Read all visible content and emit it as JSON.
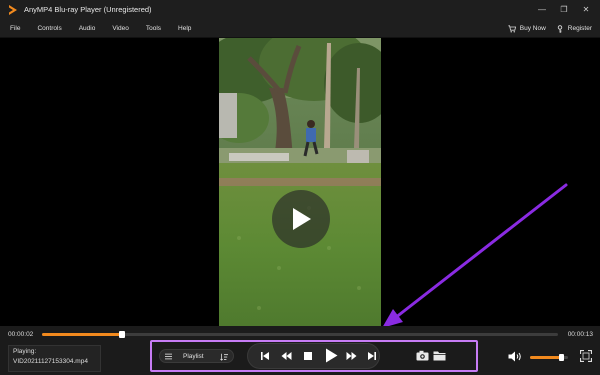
{
  "window": {
    "title": "AnyMP4 Blu-ray Player (Unregistered)",
    "minimize_glyph": "—",
    "restore_glyph": "❐",
    "close_glyph": "✕"
  },
  "menu": {
    "items": [
      "File",
      "Controls",
      "Audio",
      "Video",
      "Tools",
      "Help"
    ],
    "buy_now": "Buy Now",
    "register": "Register"
  },
  "player": {
    "current_time": "00:00:02",
    "total_time": "00:00:13",
    "progress": 0.155,
    "volume": 0.82,
    "now_playing_label": "Playing:",
    "now_playing_file": "VID20211127153304.mp4",
    "playlist_label": "Playlist"
  },
  "icons": {
    "app_logo": "anymp4-logo-icon",
    "buy_now": "cart-icon",
    "register": "key-icon",
    "play_overlay": "play-icon",
    "list_toggle": "list-icon",
    "sort": "sort-icon",
    "previous": "skip-previous-icon",
    "rewind": "rewind-icon",
    "stop": "stop-icon",
    "play": "play-icon",
    "forward": "fast-forward-icon",
    "next": "skip-next-icon",
    "snapshot": "camera-icon",
    "open_folder": "folder-icon",
    "volume": "volume-icon",
    "fullscreen": "fullscreen-icon"
  },
  "colors": {
    "accent": "#f28a1e",
    "highlight": "#c77cf5",
    "annotation_arrow": "#8a2be2",
    "chrome": "#1e1e1e"
  }
}
